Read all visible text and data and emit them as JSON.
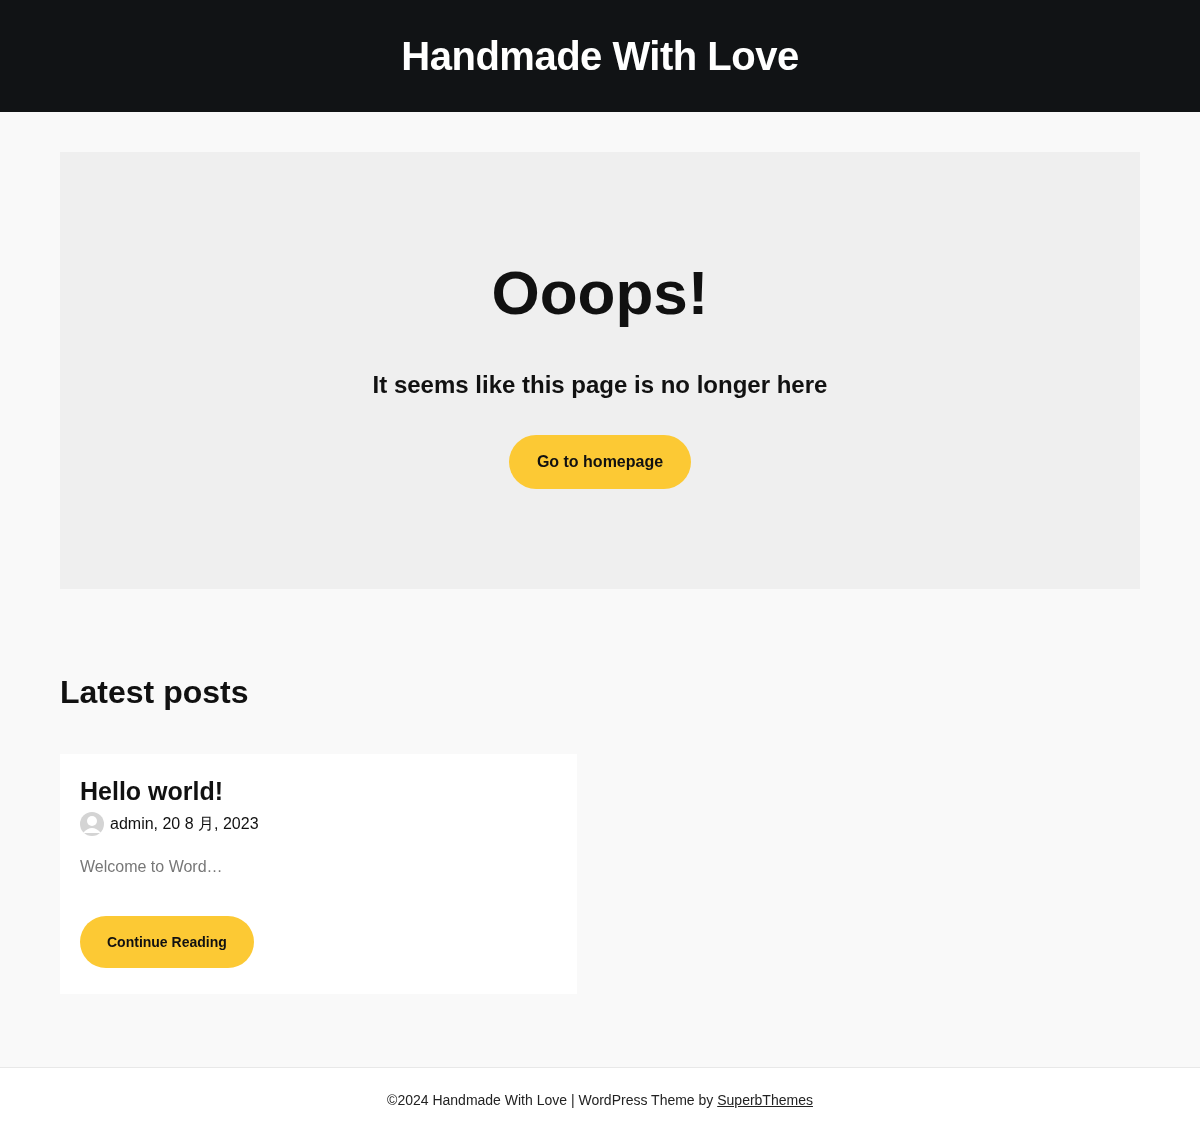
{
  "header": {
    "site_title": "Handmade With Love"
  },
  "error_panel": {
    "title": "Ooops!",
    "message": "It seems like this page is no longer here",
    "button": "Go to homepage"
  },
  "latest_posts": {
    "heading": "Latest posts",
    "posts": [
      {
        "title": "Hello world!",
        "meta": "admin, 20 8 月, 2023",
        "excerpt": "Welcome to Word…",
        "button": "Continue Reading"
      }
    ]
  },
  "footer": {
    "text": "©2024 Handmade With Love | WordPress Theme by ",
    "link": "SuperbThemes"
  }
}
